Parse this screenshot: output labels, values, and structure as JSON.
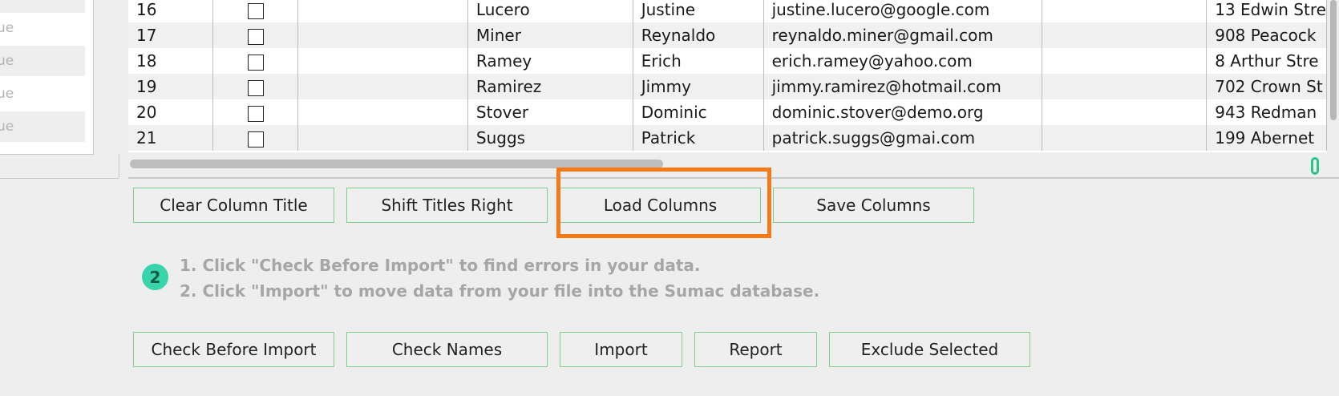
{
  "sidebar": {
    "items": [
      "ue",
      "ue",
      "ue",
      "ue"
    ]
  },
  "table": {
    "rows": [
      {
        "num": "16",
        "last": "Lucero",
        "first": "Justine",
        "email": "justine.lucero@google.com",
        "address": "13 Edwin Stre"
      },
      {
        "num": "17",
        "last": "Miner",
        "first": "Reynaldo",
        "email": "reynaldo.miner@gmail.com",
        "address": "908 Peacock"
      },
      {
        "num": "18",
        "last": "Ramey",
        "first": "Erich",
        "email": "erich.ramey@yahoo.com",
        "address": "8 Arthur Stre"
      },
      {
        "num": "19",
        "last": "Ramirez",
        "first": "Jimmy",
        "email": "jimmy.ramirez@hotmail.com",
        "address": "702 Crown St"
      },
      {
        "num": "20",
        "last": "Stover",
        "first": "Dominic",
        "email": "dominic.stover@demo.org",
        "address": "943 Redman"
      },
      {
        "num": "21",
        "last": "Suggs",
        "first": "Patrick",
        "email": "patrick.suggs@gmai.com",
        "address": "199 Abernet"
      }
    ]
  },
  "column_buttons": {
    "clear": "Clear Column Title",
    "shift": "Shift Titles Right",
    "load": "Load Columns",
    "save": "Save Columns"
  },
  "step": {
    "number": "2",
    "line1": "1. Click \"Check Before Import\" to find errors in your data.",
    "line2": "2. Click \"Import\" to move data from your file into the Sumac database."
  },
  "import_buttons": {
    "check": "Check Before Import",
    "names": "Check Names",
    "import": "Import",
    "report": "Report",
    "exclude": "Exclude Selected"
  },
  "colors": {
    "button_border": "#7fcc8f",
    "highlight": "#f47a17",
    "badge": "#3ad4ac"
  }
}
